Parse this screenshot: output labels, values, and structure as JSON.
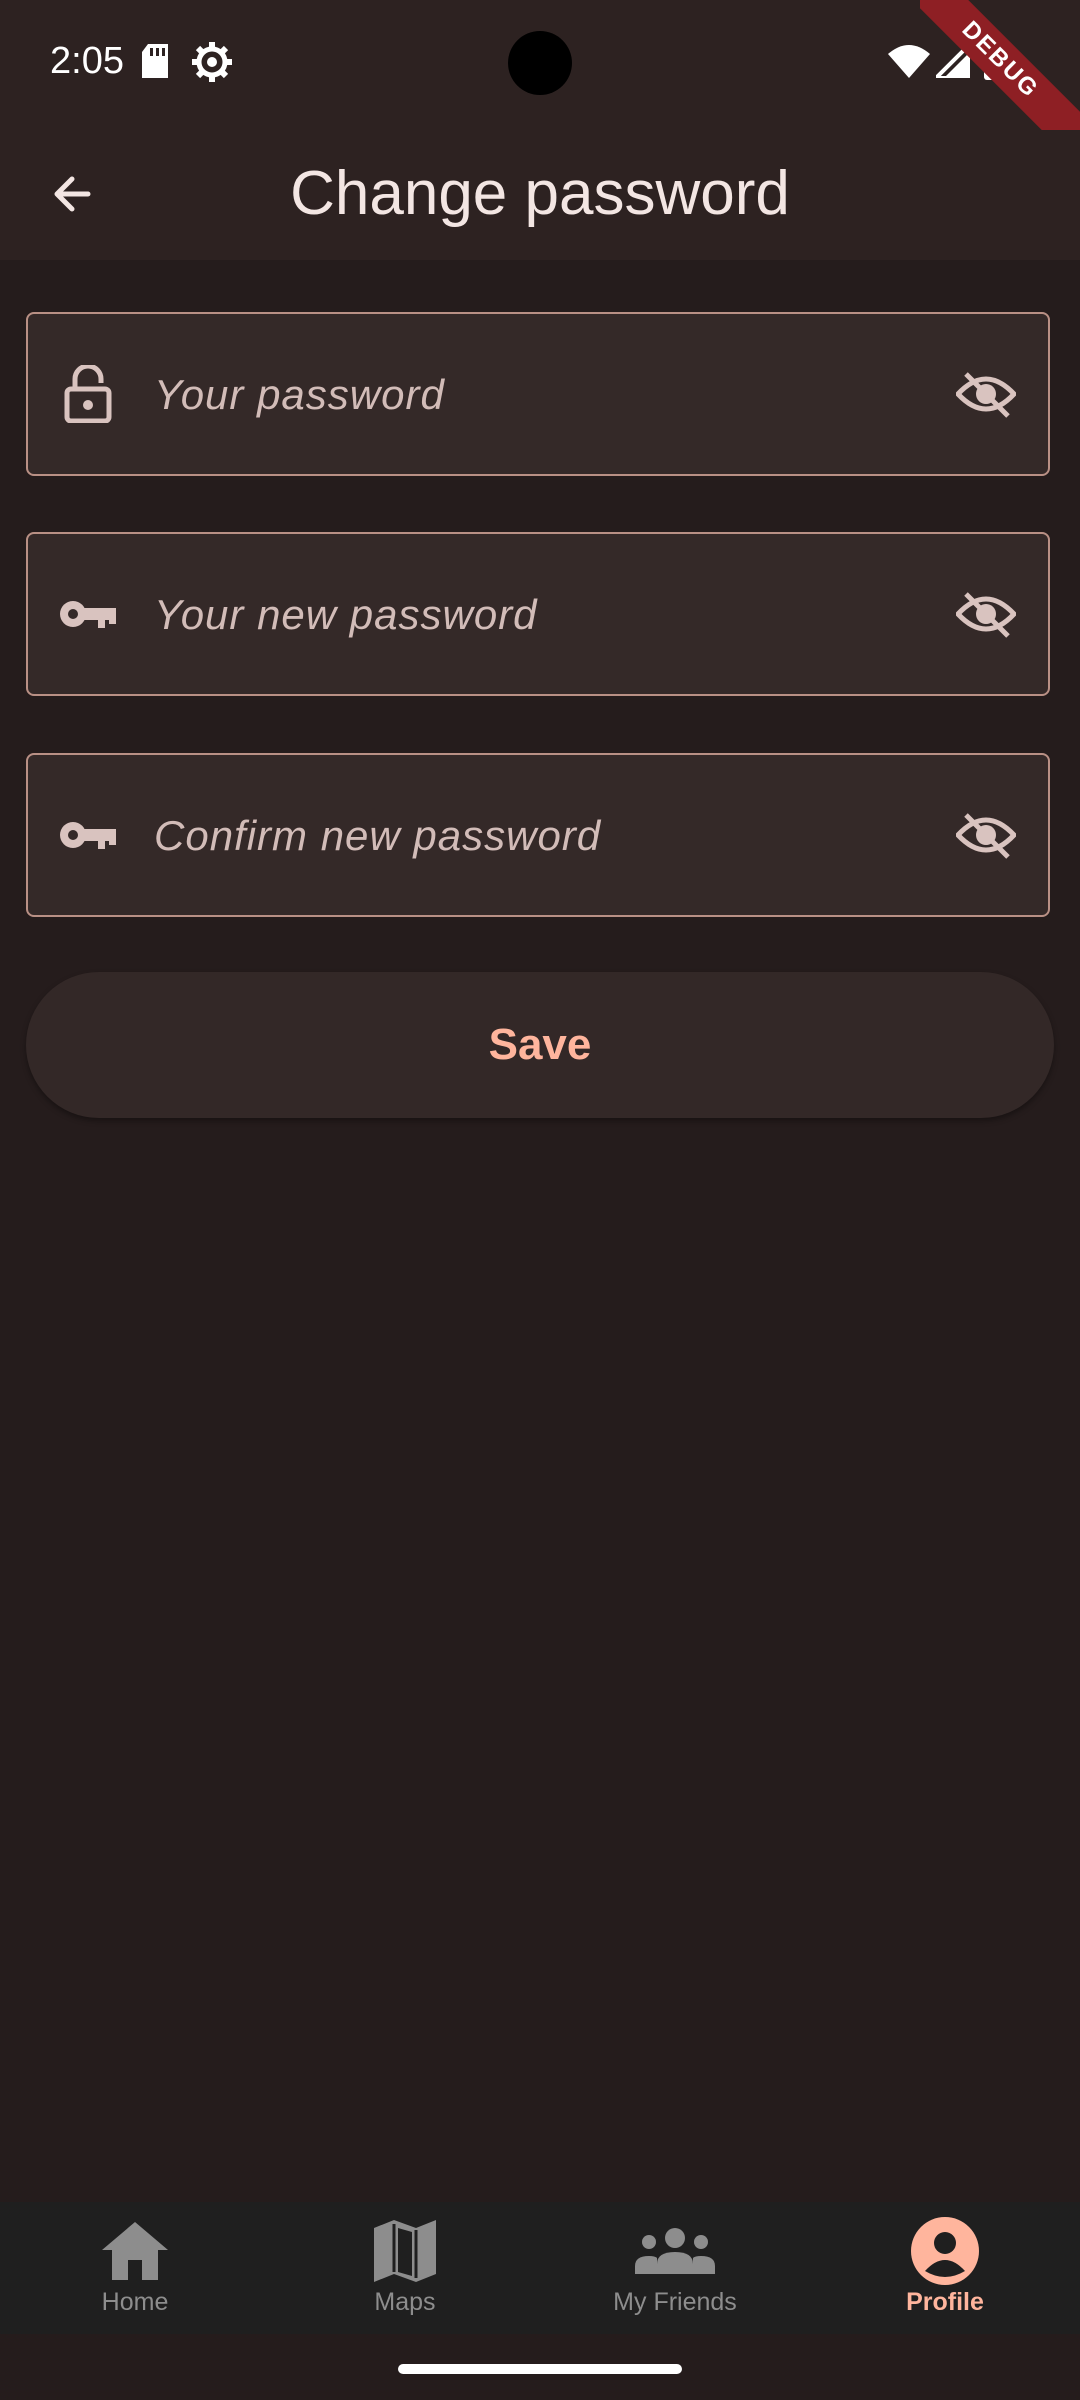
{
  "status_bar": {
    "time": "2:05"
  },
  "debug_banner": "DEBUG",
  "app_bar": {
    "title": "Change password"
  },
  "form": {
    "current_password": {
      "placeholder": "Your password",
      "value": "",
      "icon": "lock-open-icon"
    },
    "new_password": {
      "placeholder": "Your new password",
      "value": "",
      "icon": "key-icon"
    },
    "confirm_password": {
      "placeholder": "Confirm new password",
      "value": "",
      "icon": "key-icon"
    },
    "save_label": "Save"
  },
  "bottom_nav": {
    "items": [
      {
        "label": "Home",
        "icon": "home-icon",
        "active": false
      },
      {
        "label": "Maps",
        "icon": "map-icon",
        "active": false
      },
      {
        "label": "My Friends",
        "icon": "people-icon",
        "active": false
      },
      {
        "label": "Profile",
        "icon": "account-circle-icon",
        "active": true
      }
    ]
  },
  "colors": {
    "background": "#251c1c",
    "surface": "#2d2221",
    "field_fill": "#342928",
    "field_border": "#b99085",
    "accent": "#ffb59d",
    "nav_inactive": "#8d8d8d"
  }
}
